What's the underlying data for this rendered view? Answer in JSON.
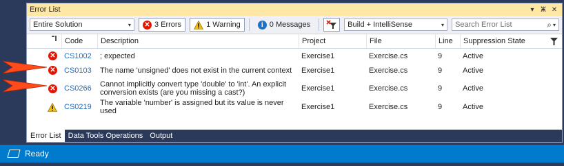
{
  "window": {
    "title": "Error List",
    "title_icons": [
      "dropdown-icon",
      "pin-icon",
      "close-icon"
    ],
    "pin_glyph": "ⵥ",
    "close_glyph": "✕",
    "dropdown_glyph": "▾"
  },
  "toolbar": {
    "scope_select": "Entire Solution",
    "errors_label": "3 Errors",
    "warnings_label": "1 Warning",
    "messages_label": "0 Messages",
    "build_select": "Build + IntelliSense",
    "search_placeholder": "Search Error List",
    "search_glyph": "⌕",
    "dropdown_glyph": "▾"
  },
  "columns": {
    "code": "Code",
    "description": "Description",
    "project": "Project",
    "file": "File",
    "line": "Line",
    "suppression": "Suppression State"
  },
  "rows": [
    {
      "severity": "error",
      "code": "CS1002",
      "description": "; expected",
      "project": "Exercise1",
      "file": "Exercise.cs",
      "line": "9",
      "suppression": "Active"
    },
    {
      "severity": "error",
      "code": "CS0103",
      "description": "The name 'unsigned' does not exist in the current context",
      "project": "Exercise1",
      "file": "Exercise.cs",
      "line": "9",
      "suppression": "Active"
    },
    {
      "severity": "error",
      "code": "CS0266",
      "description": "Cannot implicitly convert type 'double' to 'int'. An explicit conversion exists (are you missing a cast?)",
      "project": "Exercise1",
      "file": "Exercise.cs",
      "line": "9",
      "suppression": "Active"
    },
    {
      "severity": "warning",
      "code": "CS0219",
      "description": "The variable 'number' is assigned but its value is never used",
      "project": "Exercise1",
      "file": "Exercise.cs",
      "line": "9",
      "suppression": "Active"
    }
  ],
  "tabs": [
    "Error List",
    "Data Tools Operations",
    "Output"
  ],
  "status": {
    "text": "Ready"
  },
  "colors": {
    "accent": "#007acc",
    "title_bar": "#ffe8a6",
    "error": "#e51400",
    "warning": "#f6c000",
    "arrow": "#ff4a1c",
    "link": "#1e6fc6"
  }
}
